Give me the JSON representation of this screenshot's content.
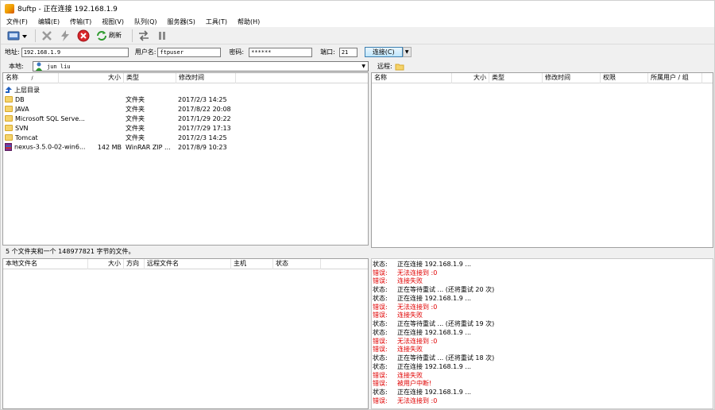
{
  "window": {
    "title": "8uftp - 正在连接 192.168.1.9"
  },
  "menu": [
    "文件(F)",
    "编辑(E)",
    "传输(T)",
    "视图(V)",
    "队列(Q)",
    "服务器(S)",
    "工具(T)",
    "帮助(H)"
  ],
  "toolbar": {
    "refresh_label": "刷新"
  },
  "connection": {
    "address_label": "地址:",
    "address_value": "192.168.1.9",
    "user_label": "用户名:",
    "user_value": "ftpuser",
    "password_label": "密码:",
    "password_value": "******",
    "port_label": "端口:",
    "port_value": "21",
    "connect_label": "连接(C)"
  },
  "local": {
    "label": "本地:",
    "path": "jun liu",
    "columns": [
      "名称",
      "大小",
      "类型",
      "修改时间"
    ],
    "sort_indicator": "/",
    "rows": [
      {
        "name": "上层目录",
        "size": "",
        "type": "",
        "modified": "",
        "icon": "up-arrow-icon"
      },
      {
        "name": "DB",
        "size": "",
        "type": "文件夹",
        "modified": "2017/2/3 14:25",
        "icon": "folder-icon"
      },
      {
        "name": "JAVA",
        "size": "",
        "type": "文件夹",
        "modified": "2017/8/22 20:08",
        "icon": "folder-icon"
      },
      {
        "name": "Microsoft SQL Serve...",
        "size": "",
        "type": "文件夹",
        "modified": "2017/1/29 20:22",
        "icon": "folder-icon"
      },
      {
        "name": "SVN",
        "size": "",
        "type": "文件夹",
        "modified": "2017/7/29 17:13",
        "icon": "folder-icon"
      },
      {
        "name": "Tomcat",
        "size": "",
        "type": "文件夹",
        "modified": "2017/2/3 14:25",
        "icon": "folder-icon"
      },
      {
        "name": "nexus-3.5.0-02-win6...",
        "size": "142 MB",
        "type": "WinRAR ZIP ...",
        "modified": "2017/8/9 10:23",
        "icon": "winrar-icon"
      }
    ],
    "status": "5 个文件夹和一个 148977821 字节的文件。"
  },
  "remote": {
    "label": "远程:",
    "columns": [
      "名称",
      "大小",
      "类型",
      "修改时间",
      "权限",
      "所属用户 / 组"
    ]
  },
  "queue": {
    "columns": [
      "本地文件名",
      "大小",
      "方向",
      "远程文件名",
      "主机",
      "状态"
    ]
  },
  "log": [
    {
      "tag": "状态:",
      "text": "正在连接 192.168.1.9 ...",
      "error": false
    },
    {
      "tag": "错误:",
      "text": "无法连接到 :0",
      "error": true
    },
    {
      "tag": "错误:",
      "text": "连接失败",
      "error": true
    },
    {
      "tag": "状态:",
      "text": "正在等待重试 ... (还将重试 20 次)",
      "error": false
    },
    {
      "tag": "状态:",
      "text": "正在连接 192.168.1.9 ...",
      "error": false
    },
    {
      "tag": "错误:",
      "text": "无法连接到 :0",
      "error": true
    },
    {
      "tag": "错误:",
      "text": "连接失败",
      "error": true
    },
    {
      "tag": "状态:",
      "text": "正在等待重试 ... (还将重试 19 次)",
      "error": false
    },
    {
      "tag": "状态:",
      "text": "正在连接 192.168.1.9 ...",
      "error": false
    },
    {
      "tag": "错误:",
      "text": "无法连接到 :0",
      "error": true
    },
    {
      "tag": "错误:",
      "text": "连接失败",
      "error": true
    },
    {
      "tag": "状态:",
      "text": "正在等待重试 ... (还将重试 18 次)",
      "error": false
    },
    {
      "tag": "状态:",
      "text": "正在连接 192.168.1.9 ...",
      "error": false
    },
    {
      "tag": "错误:",
      "text": "连接失败",
      "error": true
    },
    {
      "tag": "错误:",
      "text": "被用户中断!",
      "error": true
    },
    {
      "tag": "状态:",
      "text": "正在连接 192.168.1.9 ...",
      "error": false
    },
    {
      "tag": "错误:",
      "text": "无法连接到 :0",
      "error": true
    }
  ]
}
